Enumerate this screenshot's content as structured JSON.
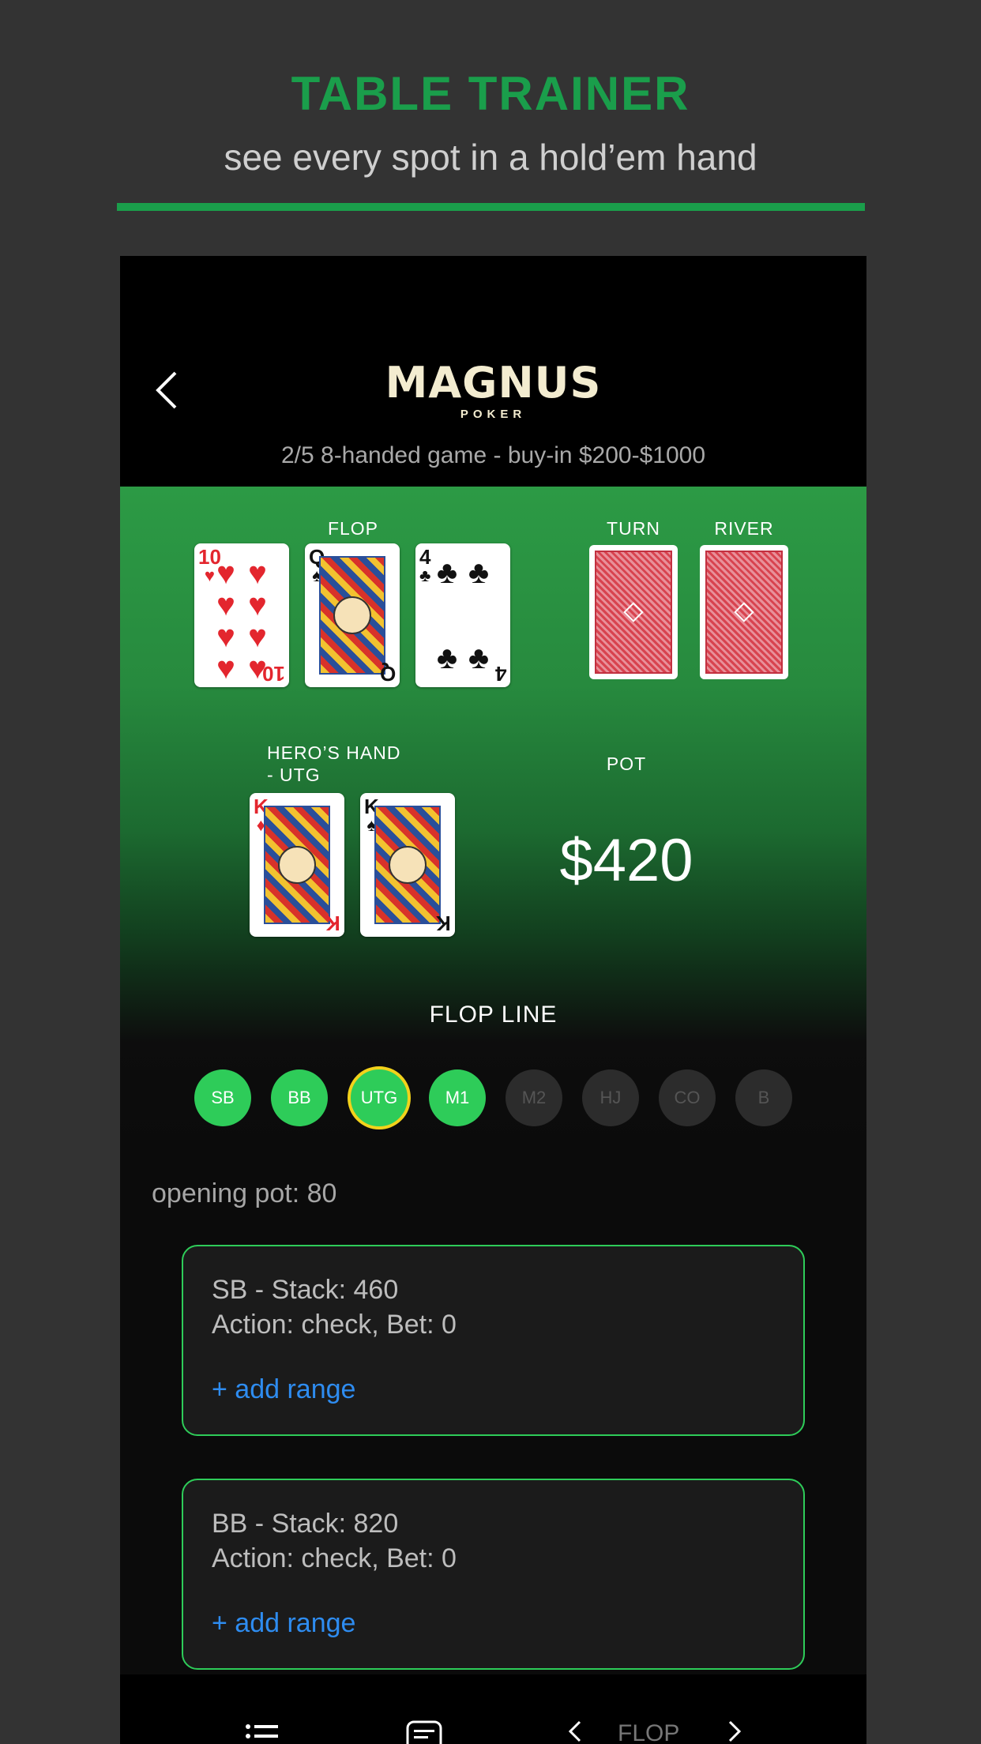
{
  "promo": {
    "title": "TABLE TRAINER",
    "subtitle": "see every spot in a hold’em hand"
  },
  "header": {
    "logo_main": "MAGNUS",
    "logo_sub": "POKER",
    "game_info": "2/5 8-handed game - buy-in $200-$1000"
  },
  "board": {
    "flop_label": "FLOP",
    "turn_label": "TURN",
    "river_label": "RIVER",
    "flop": [
      {
        "rank": "10",
        "suit": "♥"
      },
      {
        "rank": "Q",
        "suit": "♠"
      },
      {
        "rank": "4",
        "suit": "♣"
      }
    ]
  },
  "hero": {
    "label_line1": "HERO’S HAND",
    "label_line2": "- UTG",
    "cards": [
      {
        "rank": "K",
        "suit": "♦"
      },
      {
        "rank": "K",
        "suit": "♠"
      }
    ]
  },
  "pot": {
    "label": "POT",
    "value": "$420"
  },
  "street_line": {
    "title": "FLOP LINE",
    "positions": [
      "SB",
      "BB",
      "UTG",
      "M1",
      "M2",
      "HJ",
      "CO",
      "B"
    ],
    "active": [
      "SB",
      "BB",
      "UTG",
      "M1"
    ],
    "selected": "UTG"
  },
  "opening_pot": "opening pot: 80",
  "players": [
    {
      "line1": "SB - Stack: 460",
      "line2": "Action: check, Bet: 0",
      "add_range": "+ add range"
    },
    {
      "line1": "BB - Stack: 820",
      "line2": "Action: check, Bet: 0",
      "add_range": "+ add range"
    }
  ],
  "bottom_bar": {
    "stage": "FLOP"
  },
  "colors": {
    "accent": "#2ecc59",
    "promo_green": "#1a9e4b",
    "link": "#2e8cf0",
    "selected_ring": "#f2d21b"
  }
}
